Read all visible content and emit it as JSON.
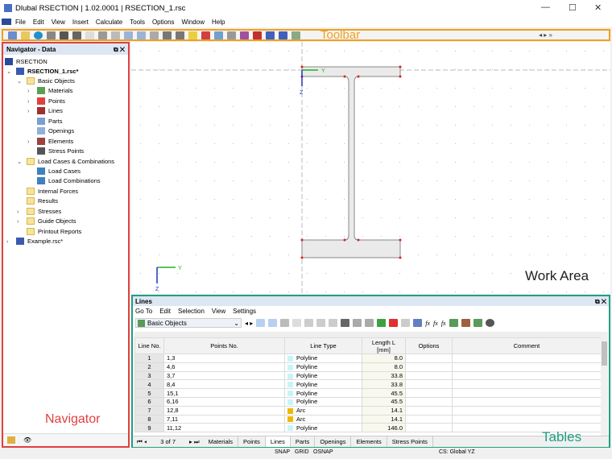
{
  "window": {
    "title": "Dlubal RSECTION | 1.02.0001 | RSECTION_1.rsc"
  },
  "menu": [
    "File",
    "Edit",
    "View",
    "Insert",
    "Calculate",
    "Tools",
    "Options",
    "Window",
    "Help"
  ],
  "annotations": {
    "toolbar": "Toolbar",
    "navigator": "Navigator",
    "work_area": "Work Area",
    "tables": "Tables"
  },
  "navigator": {
    "title": "Navigator - Data",
    "root": "RSECTION",
    "items": [
      {
        "label": "RSECTION_1.rsc*",
        "level": 0,
        "bold": true
      },
      {
        "label": "Basic Objects",
        "level": 1
      },
      {
        "label": "Materials",
        "level": 2
      },
      {
        "label": "Points",
        "level": 2
      },
      {
        "label": "Lines",
        "level": 2
      },
      {
        "label": "Parts",
        "level": 2
      },
      {
        "label": "Openings",
        "level": 2
      },
      {
        "label": "Elements",
        "level": 2
      },
      {
        "label": "Stress Points",
        "level": 2
      },
      {
        "label": "Load Cases & Combinations",
        "level": 1
      },
      {
        "label": "Load Cases",
        "level": 2
      },
      {
        "label": "Load Combinations",
        "level": 2
      },
      {
        "label": "Internal Forces",
        "level": 1
      },
      {
        "label": "Results",
        "level": 1
      },
      {
        "label": "Stresses",
        "level": 1
      },
      {
        "label": "Guide Objects",
        "level": 1
      },
      {
        "label": "Printout Reports",
        "level": 1
      },
      {
        "label": "Example.rsc*",
        "level": 0
      }
    ]
  },
  "tables": {
    "title": "Lines",
    "menu": [
      "Go To",
      "Edit",
      "Selection",
      "View",
      "Settings"
    ],
    "selector": "Basic Objects",
    "headers": [
      "Line No.",
      "Points No.",
      "Line Type",
      "Length L [mm]",
      "Options",
      "Comment"
    ],
    "rows": [
      [
        "1",
        "1,3",
        "Polyline",
        "8.0"
      ],
      [
        "2",
        "4,6",
        "Polyline",
        "8.0"
      ],
      [
        "3",
        "3,7",
        "Polyline",
        "33.8"
      ],
      [
        "4",
        "8,4",
        "Polyline",
        "33.8"
      ],
      [
        "5",
        "15,1",
        "Polyline",
        "45.5"
      ],
      [
        "6",
        "6,16",
        "Polyline",
        "45.5"
      ],
      [
        "7",
        "12,8",
        "Arc",
        "14.1"
      ],
      [
        "8",
        "7,11",
        "Arc",
        "14.1"
      ],
      [
        "9",
        "11,12",
        "Polyline",
        "146.0"
      ]
    ],
    "type_colors": {
      "Polyline": "#c8f4f8",
      "Arc": "#f0b800"
    },
    "pager": "3 of 7",
    "tabs": [
      "Materials",
      "Points",
      "Lines",
      "Parts",
      "Openings",
      "Elements",
      "Stress Points"
    ],
    "active_tab": "Lines"
  },
  "status": {
    "snap": "SNAP",
    "grid": "GRID",
    "osnap": "OSNAP",
    "cs": "CS: Global YZ"
  },
  "axes": {
    "y": "Y",
    "z": "Z"
  }
}
